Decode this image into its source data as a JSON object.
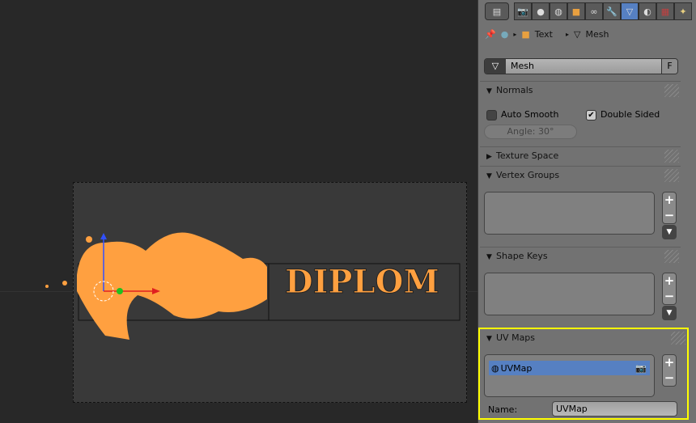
{
  "viewport": {
    "text_object": "DIPLOM"
  },
  "properties": {
    "tabs": [
      "render",
      "scene",
      "world",
      "object",
      "constraints",
      "modifiers",
      "data",
      "material",
      "texture",
      "particles"
    ],
    "active_tab": "data",
    "breadcrumb": {
      "item1": "Text",
      "item2": "Mesh"
    },
    "mesh_name": "Mesh",
    "fake_user": "F",
    "normals": {
      "title": "Normals",
      "auto_smooth": "Auto Smooth",
      "auto_smooth_checked": false,
      "double_sided": "Double Sided",
      "double_sided_checked": true,
      "angle": "Angle: 30°"
    },
    "texture_space": {
      "title": "Texture Space"
    },
    "vertex_groups": {
      "title": "Vertex Groups"
    },
    "shape_keys": {
      "title": "Shape Keys"
    },
    "uv_maps": {
      "title": "UV Maps",
      "items": [
        "UVMap"
      ],
      "name_label": "Name:",
      "name_value": "UVMap",
      "highlight_color": "#ffff00"
    }
  },
  "colors": {
    "accent": "#5680c2",
    "selection": "#ffa040"
  }
}
